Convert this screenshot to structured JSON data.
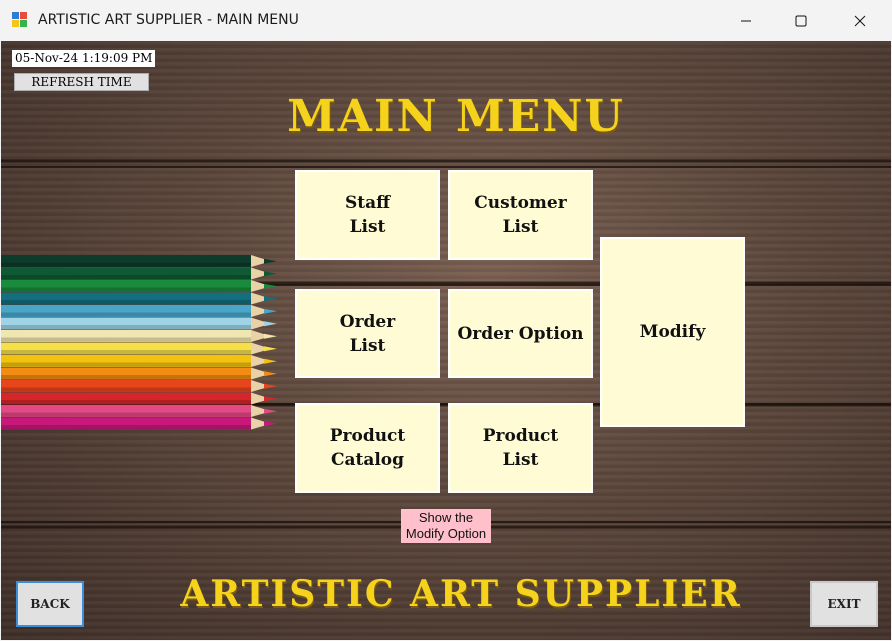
{
  "window": {
    "title": "ARTISTIC ART SUPPLIER - MAIN MENU",
    "minimize_icon": "minimize-icon",
    "maximize_icon": "maximize-icon",
    "close_icon": "close-icon"
  },
  "datetime": "05-Nov-24 1:19:09 PM",
  "refresh_label": "REFRESH TIME",
  "heading": "MAIN MENU",
  "tiles": {
    "staff": "Staff\nList",
    "customer": "Customer\nList",
    "order_list": "Order\nList",
    "order_option": "Order Option",
    "product_catalog": "Product\nCatalog",
    "product_list": "Product\nList",
    "modify": "Modify"
  },
  "tooltip": "Show the\nModify Option",
  "footer_title": "ARTISTIC ART SUPPLIER",
  "back_label": "BACK",
  "exit_label": "EXIT",
  "colors": {
    "title_yellow": "#f5d21c",
    "tile_bg": "#fffbd5",
    "tooltip_bg": "#ffc0cb",
    "focus_blue": "#3a8fd8"
  },
  "pencil_colors": [
    "#0d3b2c",
    "#0f5a35",
    "#1a8a3c",
    "#12707e",
    "#4aa6c9",
    "#9fd3e6",
    "#f0e6b0",
    "#f5e04a",
    "#f2c20f",
    "#f28c12",
    "#e8451c",
    "#d6262a",
    "#e24a86",
    "#c8197a"
  ]
}
